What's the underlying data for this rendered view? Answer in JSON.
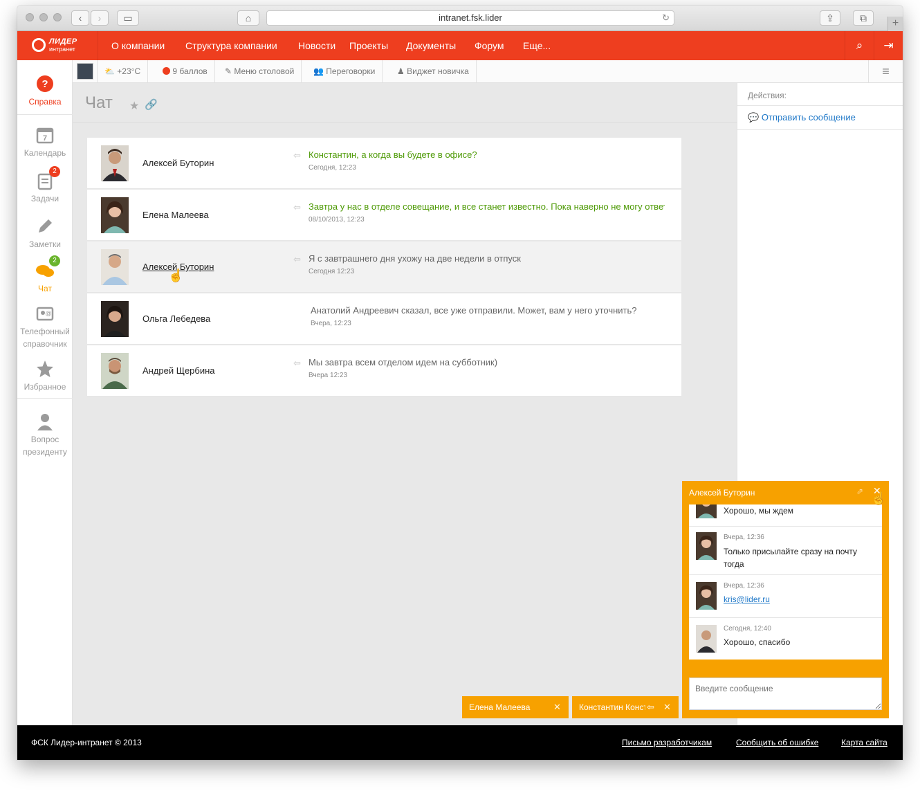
{
  "browser": {
    "url": "intranet.fsk.lider"
  },
  "brand": {
    "name": "ЛИДЕР",
    "sub": "интранет"
  },
  "topnav": {
    "items": [
      "О компании",
      "Структура компании",
      "Новости",
      "Проекты",
      "Документы",
      "Форум",
      "Еще..."
    ]
  },
  "toolbar": {
    "weather": "+23°C",
    "points": "9 баллов",
    "menu": "Меню столовой",
    "meetings": "Переговорки",
    "newbie": "Виджет новичка"
  },
  "sidebar": {
    "items": [
      {
        "label": "Справка",
        "icon": "help-icon"
      },
      {
        "label": "Календарь",
        "icon": "calendar-icon",
        "sub": "7"
      },
      {
        "label": "Задачи",
        "icon": "tasks-icon",
        "badge": "2"
      },
      {
        "label": "Заметки",
        "icon": "pencil-icon"
      },
      {
        "label": "Чат",
        "icon": "chat-icon",
        "badge": "2"
      },
      {
        "label": "Телефонный справочник",
        "line1": "Телефонный",
        "line2": "справочник",
        "icon": "phonebook-icon"
      },
      {
        "label": "Избранное",
        "icon": "star-icon"
      },
      {
        "label": "Вопрос президенту",
        "line1": "Вопрос",
        "line2": "президенту",
        "icon": "president-icon"
      }
    ]
  },
  "page": {
    "title": "Чат"
  },
  "chats": [
    {
      "name": "Алексей Буторин",
      "message": "Константин, а когда вы будете в офисе?",
      "time": "Сегодня, 12:23",
      "unread": true,
      "incoming": true
    },
    {
      "name": "Елена Малеева",
      "message": "Завтра у нас в отделе совещание, и все станет известно. Пока наверно не могу ответить",
      "time": "08/10/2013, 12:23",
      "unread": true,
      "incoming": true
    },
    {
      "name": "Алексей Буторин",
      "message": "Я с завтрашнего дня ухожу на две недели в отпуск",
      "time": "Сегодня 12:23",
      "unread": false,
      "incoming": true
    },
    {
      "name": "Ольга Лебедева",
      "message": "Анатолий Андреевич сказал, все уже отправили. Может, вам у него уточнить?",
      "time": "Вчера, 12:23",
      "unread": false,
      "incoming": false
    },
    {
      "name": "Андрей Щербина",
      "message": "Мы завтра всем отделом идем на субботник)",
      "time": "Вчера 12:23",
      "unread": false,
      "incoming": true
    }
  ],
  "actions": {
    "header": "Действия:",
    "send": "Отправить сообщение"
  },
  "chat_window": {
    "title": "Алексей Буторин",
    "messages": [
      {
        "time": "",
        "text": "Хорошо, мы ждем"
      },
      {
        "time": "Вчера, 12:36",
        "text": "Только присылайте сразу на почту тогда"
      },
      {
        "time": "Вчера, 12:36",
        "link": "kris@lider.ru"
      },
      {
        "time": "Сегодня, 12:40",
        "text": "Хорошо, спасибо"
      }
    ],
    "placeholder": "Введите сообщение"
  },
  "tabs": [
    {
      "name": "Елена Малеева"
    },
    {
      "name": "Константин Константинович"
    }
  ],
  "footer": {
    "copyright": "ФСК Лидер-интранет © 2013",
    "links": [
      "Письмо разработчикам",
      "Сообщить об ошибке",
      "Карта сайта"
    ]
  },
  "colors": {
    "brand": "#ee3e1f",
    "chat_accent": "#f7a100",
    "unread_text": "#4e9a06",
    "link": "#1f78c8"
  }
}
